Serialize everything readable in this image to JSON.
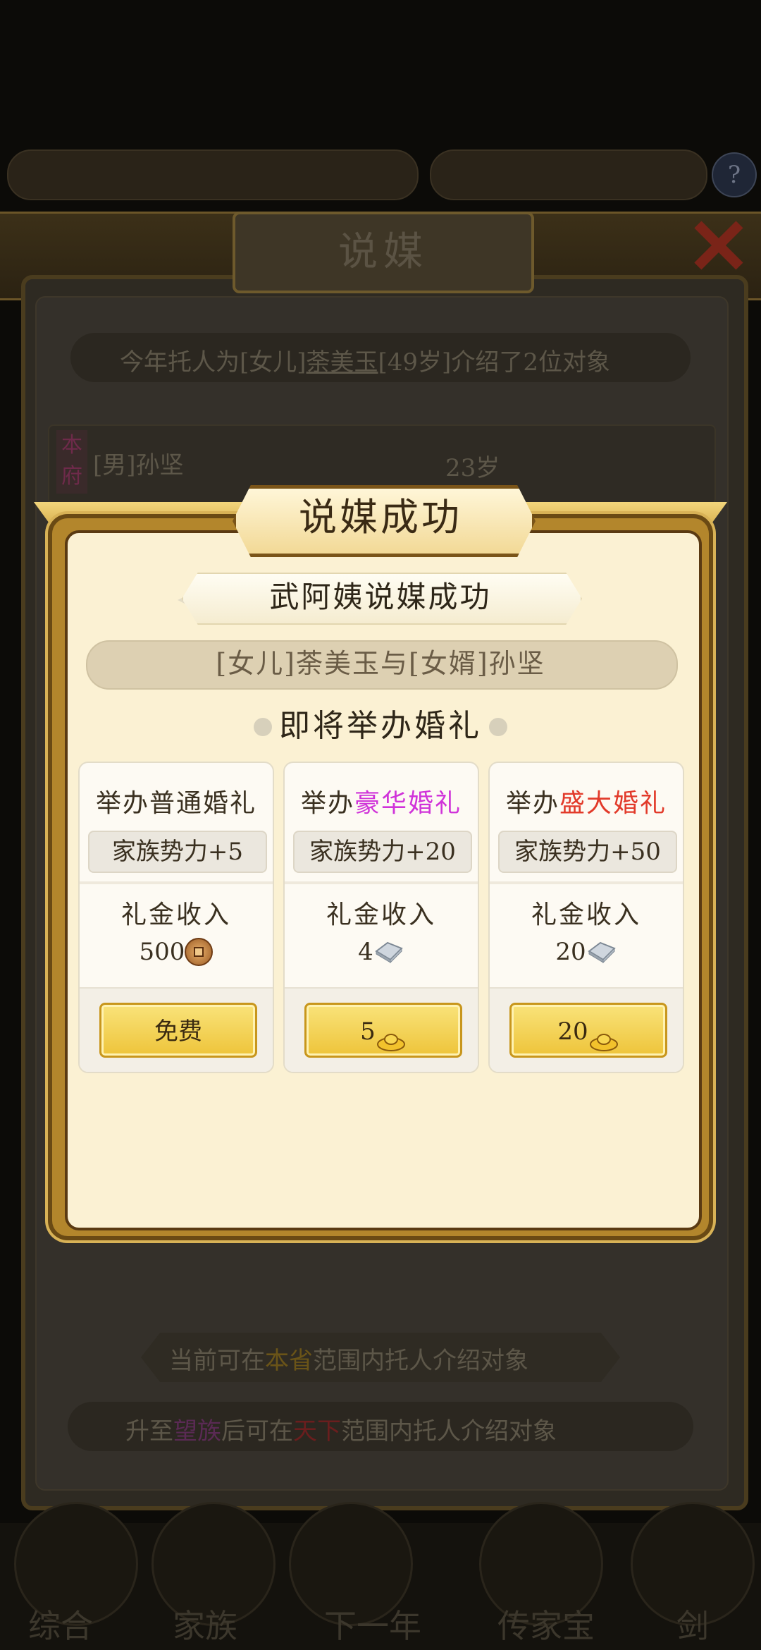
{
  "background": {
    "title": "说媒",
    "intro": {
      "prefix": "今年托人为[女儿]",
      "name": "荼美玉",
      "suffix": "[49岁]介绍了2位对象"
    },
    "candidate": {
      "tag": "本府",
      "name": "[男]孙坚",
      "age": "23岁"
    },
    "province_line": {
      "prefix": "当前可在",
      "highlight": "本省",
      "suffix": "范围内托人介绍对象"
    },
    "upgrade_line": {
      "prefix": "升至",
      "hl1": "望族",
      "middle": "后可在",
      "hl2": "天下",
      "suffix": "范围内托人介绍对象"
    },
    "nav": [
      "综合",
      "家族",
      "下一年",
      "传家宝",
      "剑"
    ]
  },
  "popup": {
    "title": "说媒成功",
    "subtitle": "武阿姨说媒成功",
    "couple": "[女儿]荼美玉与[女婿]孙坚",
    "heading": "即将举办婚礼",
    "income_label": "礼金收入",
    "cards": [
      {
        "title_prefix": "举办",
        "title_hl": "普通婚礼",
        "hl_color": "#3a3020",
        "bonus": "家族势力+5",
        "income_value": "500",
        "income_icon": "copper-coin-icon",
        "button_label": "免费"
      },
      {
        "title_prefix": "举办",
        "title_hl": "豪华婚礼",
        "hl_color": "#d033d9",
        "bonus": "家族势力+20",
        "income_value": "4",
        "income_icon": "silver-ingot-icon",
        "button_label": "5",
        "button_icon": "gold-ingot-icon"
      },
      {
        "title_prefix": "举办",
        "title_hl": "盛大婚礼",
        "hl_color": "#e23a2a",
        "bonus": "家族势力+50",
        "income_value": "20",
        "income_icon": "silver-ingot-icon",
        "button_label": "20",
        "button_icon": "gold-ingot-icon"
      }
    ]
  }
}
